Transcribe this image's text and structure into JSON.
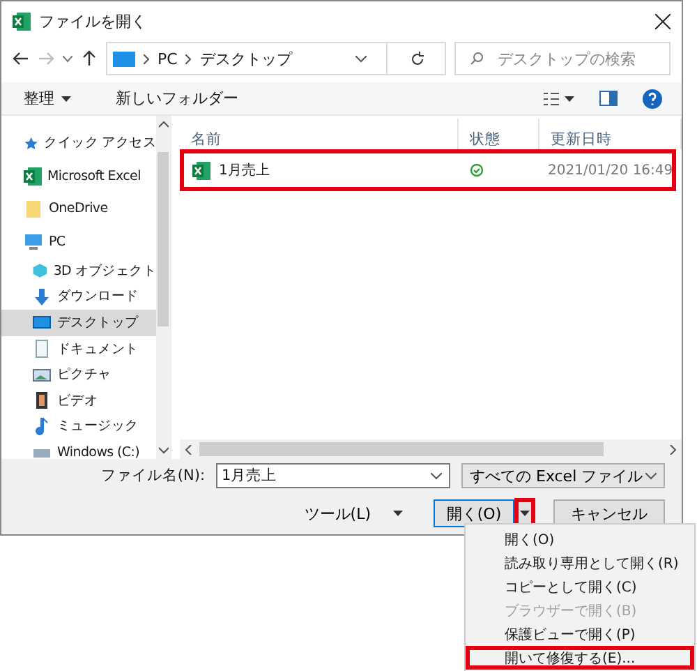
{
  "window": {
    "title": "ファイルを開く"
  },
  "address": {
    "path": [
      "PC",
      "デスクトップ"
    ]
  },
  "search": {
    "placeholder": "デスクトップの検索"
  },
  "toolbar": {
    "organize": "整理",
    "new_folder": "新しいフォルダー"
  },
  "nav": [
    {
      "label": "クイック アクセス",
      "kind": "star",
      "selected": false
    },
    {
      "label": "Microsoft Excel",
      "kind": "excel",
      "selected": false
    },
    {
      "label": "OneDrive",
      "kind": "folder",
      "selected": false
    },
    {
      "label": "PC",
      "kind": "pc",
      "selected": false,
      "children": [
        {
          "label": "3D オブジェクト",
          "kind": "cube",
          "selected": false
        },
        {
          "label": "ダウンロード",
          "kind": "download",
          "selected": false
        },
        {
          "label": "デスクトップ",
          "kind": "desktop",
          "selected": true
        },
        {
          "label": "ドキュメント",
          "kind": "document",
          "selected": false
        },
        {
          "label": "ピクチャ",
          "kind": "picture",
          "selected": false
        },
        {
          "label": "ビデオ",
          "kind": "video",
          "selected": false
        },
        {
          "label": "ミュージック",
          "kind": "music",
          "selected": false
        },
        {
          "label": "Windows (C:)",
          "kind": "drive",
          "selected": false
        }
      ]
    }
  ],
  "columns": [
    "名前",
    "状態",
    "更新日時"
  ],
  "files": [
    {
      "name": "1月売上",
      "synced": true,
      "modified": "2021/01/20 16:49",
      "highlighted": true
    }
  ],
  "footer": {
    "filename_label": "ファイル名(N):",
    "filename": "1月売上",
    "filter": "すべての Excel ファイル",
    "tools": "ツール(L)",
    "open": "開く(O)",
    "cancel": "キャンセル",
    "split_highlighted": true
  },
  "menu": [
    {
      "label": "開く(O)",
      "disabled": false,
      "highlighted": false
    },
    {
      "label": "読み取り専用として開く(R)",
      "disabled": false,
      "highlighted": false
    },
    {
      "label": "コピーとして開く(C)",
      "disabled": false,
      "highlighted": false
    },
    {
      "label": "ブラウザーで開く(B)",
      "disabled": true,
      "highlighted": false
    },
    {
      "label": "保護ビューで開く(P)",
      "disabled": false,
      "highlighted": false
    },
    {
      "label": "開いて修復する(E)...",
      "disabled": false,
      "highlighted": true
    }
  ]
}
